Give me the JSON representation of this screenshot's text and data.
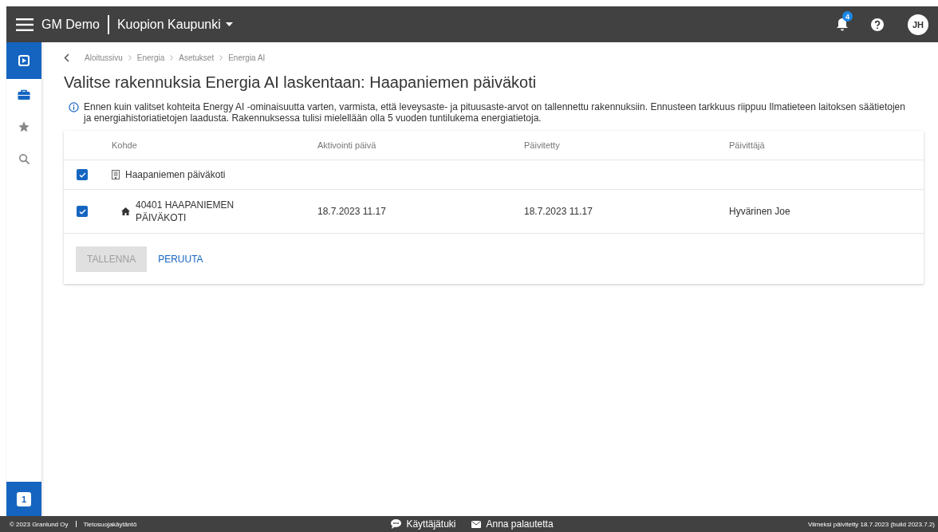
{
  "topbar": {
    "app_name": "GM Demo",
    "site": "Kuopion Kaupunki",
    "notification_count": "4",
    "user_initials": "JH"
  },
  "sidebar": {
    "items": [
      {
        "kind": "dashboard",
        "selected": true
      },
      {
        "kind": "briefcase",
        "selected": false
      },
      {
        "kind": "star",
        "selected": false
      },
      {
        "kind": "search",
        "selected": false
      }
    ],
    "bottom_badge": "1"
  },
  "breadcrumbs": [
    "Aloitussivu",
    "Energia",
    "Asetukset",
    "Energia AI"
  ],
  "title": "Valitse rakennuksia Energia AI laskentaan: Haapaniemen päiväkoti",
  "info": "Ennen kuin valitset kohteita Energy AI -ominaisuutta varten, varmista, että leveysaste- ja pituusaste-arvot on tallennettu rakennuksiin. Ennusteen tarkkuus riippuu Ilmatieteen laitoksen säätietojen ja energiahistoriatietojen laadusta. Rakennuksessa tulisi mielellään olla 5 vuoden tuntilukema energiatietoja.",
  "table": {
    "columns": [
      "Kohde",
      "Aktivointi päivä",
      "Päivitetty",
      "Päivittäjä"
    ],
    "rows": [
      {
        "kind": "site",
        "checked": true,
        "name": "Haapaniemen päiväkoti",
        "children": [
          {
            "kind": "building",
            "checked": true,
            "name": "40401 HAAPANIEMEN PÄIVÄKOTI",
            "activation": "18.7.2023 11.17",
            "updated": "18.7.2023 11.17",
            "updater": "Hyvärinen Joe"
          }
        ]
      }
    ]
  },
  "buttons": [
    {
      "label": "TALLENNA",
      "disabled": true
    },
    {
      "label": "PERUUTA",
      "disabled": false
    }
  ],
  "footer": {
    "copyright": "© 2023 Granlund Oy",
    "privacy": "Tietosuojakäytäntö",
    "support": "Käyttäjätuki",
    "feedback": "Anna palautetta",
    "updated": "Viimeksi päivitetty 18.7.2023 (build 2023.7.2)"
  }
}
